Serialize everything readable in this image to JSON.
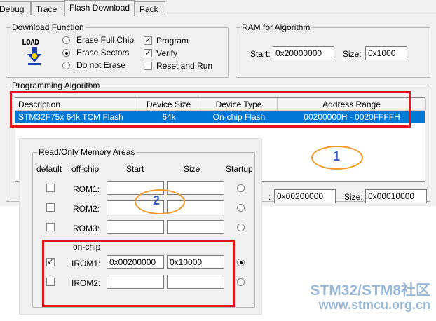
{
  "tabs": [
    {
      "label": "Debug"
    },
    {
      "label": "Trace"
    },
    {
      "label": "Flash Download"
    },
    {
      "label": "Pack"
    }
  ],
  "download_function": {
    "title": "Download Function",
    "icon_text": "LOAD",
    "radios": [
      {
        "label": "Erase Full Chip",
        "selected": false
      },
      {
        "label": "Erase Sectors",
        "selected": true
      },
      {
        "label": "Do not Erase",
        "selected": false
      }
    ],
    "checks": [
      {
        "label": "Program",
        "checked": true
      },
      {
        "label": "Verify",
        "checked": true
      },
      {
        "label": "Reset and Run",
        "checked": false
      }
    ]
  },
  "ram": {
    "title": "RAM for Algorithm",
    "start_label": "Start:",
    "start_value": "0x20000000",
    "size_label": "Size:",
    "size_value": "0x1000"
  },
  "algorithm": {
    "title": "Programming Algorithm",
    "columns": [
      "Description",
      "Device Size",
      "Device Type",
      "Address Range"
    ],
    "row": {
      "description": "STM32F75x 64k TCM Flash",
      "size": "64k",
      "type": "On-chip Flash",
      "range": "00200000H - 0020FFFFH"
    },
    "start_label": ":",
    "start_value": "0x00200000",
    "size_label": "Size:",
    "size_value": "0x00010000"
  },
  "memory": {
    "title": "Read/Only Memory Areas",
    "col_default": "default",
    "col_offchip": "off-chip",
    "col_start": "Start",
    "col_size": "Size",
    "col_startup": "Startup",
    "onchip_label": "on-chip",
    "rows": [
      {
        "name": "ROM1:",
        "default": false,
        "start": "",
        "size": "",
        "startup": false
      },
      {
        "name": "ROM2:",
        "default": false,
        "start": "",
        "size": "",
        "startup": false
      },
      {
        "name": "ROM3:",
        "default": false,
        "start": "",
        "size": "",
        "startup": false
      },
      {
        "name": "IROM1:",
        "default": true,
        "start": "0x00200000",
        "size": "0x10000",
        "startup": true
      },
      {
        "name": "IROM2:",
        "default": false,
        "start": "",
        "size": "",
        "startup": false
      }
    ]
  },
  "annotations": {
    "one": "1",
    "two": "2"
  },
  "watermark": {
    "line1": "STM32/STM8社区",
    "line2": "www.stmcu.org.cn"
  }
}
